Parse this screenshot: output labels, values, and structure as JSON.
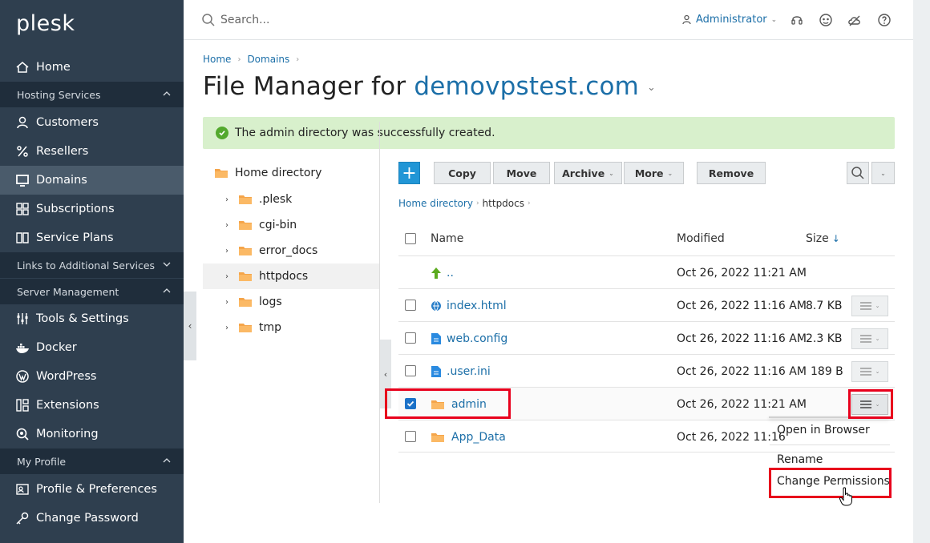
{
  "app": {
    "logo": "plesk"
  },
  "sidebar": {
    "items": [
      {
        "label": "Home",
        "icon": "home-icon"
      },
      {
        "label": "Hosting Services",
        "type": "section",
        "expanded": true
      },
      {
        "label": "Customers",
        "icon": "user-icon"
      },
      {
        "label": "Resellers",
        "icon": "percent-icon"
      },
      {
        "label": "Domains",
        "icon": "monitor-icon",
        "active": true
      },
      {
        "label": "Subscriptions",
        "icon": "grid-icon"
      },
      {
        "label": "Service Plans",
        "icon": "book-icon"
      },
      {
        "label": "Links to Additional Services",
        "type": "section",
        "expanded": false
      },
      {
        "label": "Server Management",
        "type": "section",
        "expanded": true
      },
      {
        "label": "Tools & Settings",
        "icon": "sliders-icon"
      },
      {
        "label": "Docker",
        "icon": "docker-icon"
      },
      {
        "label": "WordPress",
        "icon": "wordpress-icon"
      },
      {
        "label": "Extensions",
        "icon": "extensions-icon"
      },
      {
        "label": "Monitoring",
        "icon": "monitoring-icon"
      },
      {
        "label": "My Profile",
        "type": "section",
        "expanded": true
      },
      {
        "label": "Profile & Preferences",
        "icon": "profile-icon"
      },
      {
        "label": "Change Password",
        "icon": "key-icon"
      }
    ]
  },
  "header": {
    "search_placeholder": "Search...",
    "user": "Administrator"
  },
  "breadcrumb": [
    "Home",
    "Domains"
  ],
  "title": {
    "prefix": "File Manager for",
    "domain": "demovpstest.com"
  },
  "alert": {
    "message": "The admin directory was successfully created.",
    "color": "#d8f0cc"
  },
  "tree": {
    "root": "Home directory",
    "items": [
      {
        "label": ".plesk"
      },
      {
        "label": "cgi-bin"
      },
      {
        "label": "error_docs"
      },
      {
        "label": "httpdocs",
        "selected": true
      },
      {
        "label": "logs"
      },
      {
        "label": "tmp"
      }
    ]
  },
  "toolbar": {
    "add": "+",
    "copy": "Copy",
    "move": "Move",
    "archive": "Archive",
    "more": "More",
    "remove": "Remove"
  },
  "path": {
    "root": "Home directory",
    "current": "httpdocs"
  },
  "table": {
    "columns": {
      "name": "Name",
      "modified": "Modified",
      "size": "Size",
      "size_sort": "↓"
    },
    "rows": [
      {
        "name": "..",
        "modified": "Oct 26, 2022 11:21 AM",
        "size": "",
        "type": "up"
      },
      {
        "name": "index.html",
        "modified": "Oct 26, 2022 11:16 AM",
        "size": "8.7 KB",
        "type": "html"
      },
      {
        "name": "web.config",
        "modified": "Oct 26, 2022 11:16 AM",
        "size": "2.3 KB",
        "type": "file"
      },
      {
        "name": ".user.ini",
        "modified": "Oct 26, 2022 11:16 AM",
        "size": "189 B",
        "type": "file"
      },
      {
        "name": "admin",
        "modified": "Oct 26, 2022 11:21 AM",
        "size": "",
        "type": "folder",
        "checked": true
      },
      {
        "name": "App_Data",
        "modified": "Oct 26, 2022 11:16",
        "size": "",
        "type": "folder"
      }
    ]
  },
  "context_menu": {
    "items": [
      "Open in Browser",
      "Rename",
      "Change Permissions"
    ]
  },
  "colors": {
    "sidebar": "#2f3f4f",
    "section": "#1f2d3b",
    "accent": "#1c6fa8",
    "highlight": "#e8001c"
  }
}
